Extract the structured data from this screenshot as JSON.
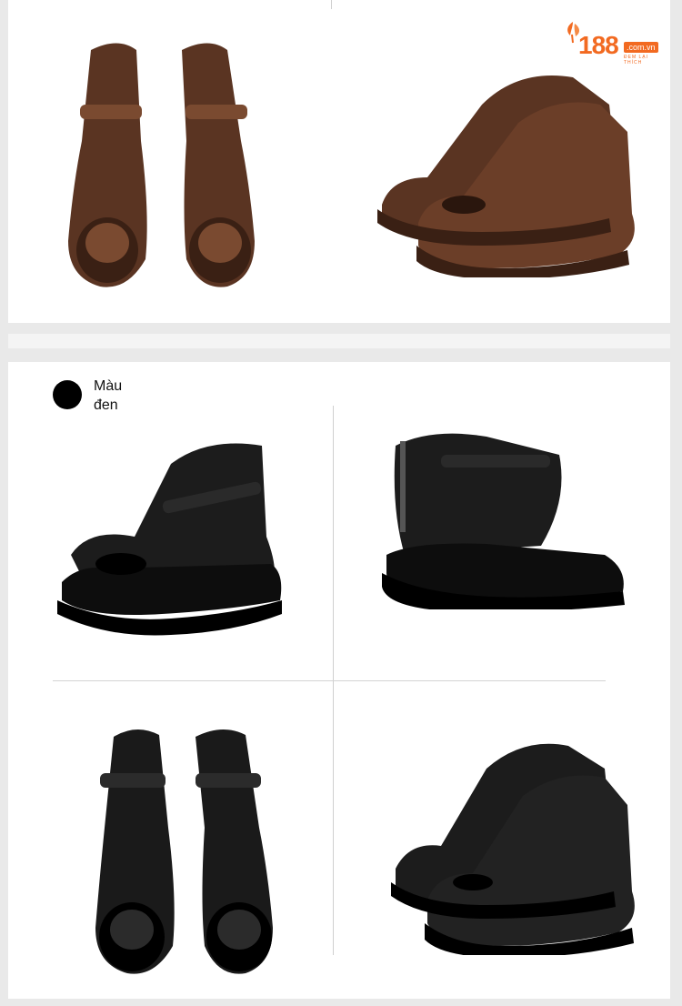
{
  "logo": {
    "number": "188",
    "domain": ".com.vn",
    "tagline": "ĐEM LẠI THÍCH"
  },
  "color_section": {
    "label_line1": "Màu",
    "label_line2": "đen",
    "swatch_color": "#000000"
  },
  "colors": {
    "brown": "#5a3422",
    "black": "#141414",
    "accent": "#f26a21"
  }
}
